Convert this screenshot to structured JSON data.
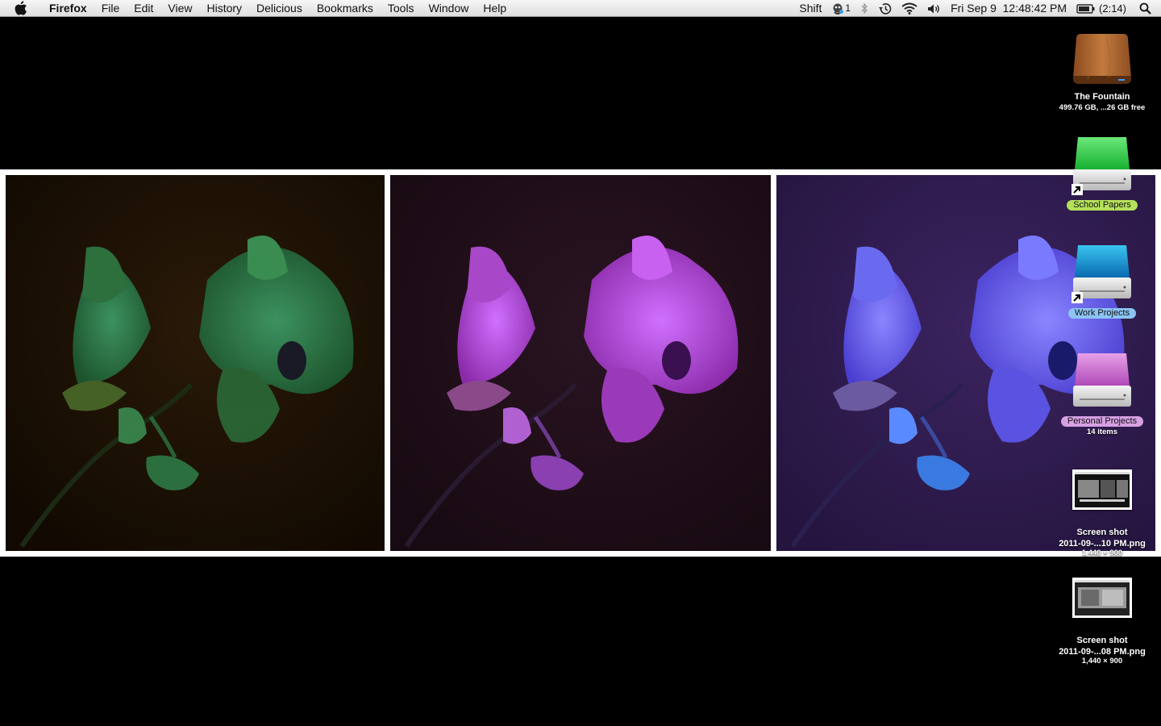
{
  "menubar": {
    "apple_icon": "apple-icon",
    "app_name": "Firefox",
    "menus": [
      "File",
      "Edit",
      "View",
      "History",
      "Delicious",
      "Bookmarks",
      "Tools",
      "Window",
      "Help"
    ],
    "status": {
      "keyboard_label": "Shift",
      "growl_count": "1",
      "datetime": "Fri Sep 9  12:48:42 PM",
      "battery_time": "(2:14)"
    }
  },
  "wallpaper": {
    "panels": [
      {
        "tint": "green",
        "bg": "#1a1005",
        "petal": "#2f8a4e"
      },
      {
        "tint": "magenta",
        "bg": "#1e0f18",
        "petal": "#b443d8"
      },
      {
        "tint": "blue-violet",
        "bg": "#2c1848",
        "petal": "#6e5ef0"
      }
    ]
  },
  "desktop": {
    "icons": [
      {
        "name": "The Fountain",
        "sub": "499.76 GB, ...26 GB free",
        "kind": "wood-drive-icon"
      },
      {
        "name": "School Papers",
        "sub": "",
        "kind": "green-drive-alias-icon",
        "label_color": "#b4e05a"
      },
      {
        "name": "Work Projects",
        "sub": "",
        "kind": "blue-drive-alias-icon",
        "label_color": "#8cc4f4"
      },
      {
        "name": "Personal Projects",
        "sub": "14 items",
        "kind": "pink-drive-icon",
        "label_color": "#d8a0e4"
      },
      {
        "name": "Screen shot",
        "name2": "2011-09-...10 PM.png",
        "sub": "1,440 × 900",
        "kind": "screenshot-thumbnail"
      },
      {
        "name": "Screen shot",
        "name2": "2011-09-...08 PM.png",
        "sub": "1,440 × 900",
        "kind": "screenshot-thumbnail"
      }
    ]
  }
}
